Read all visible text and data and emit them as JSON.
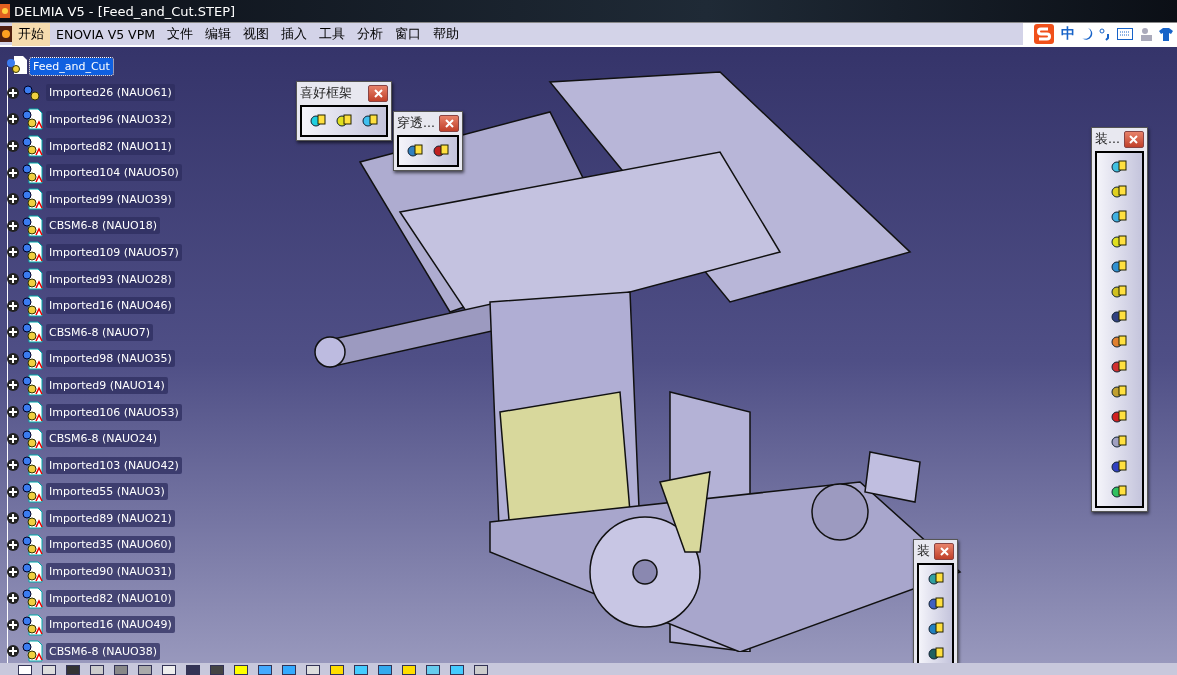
{
  "window": {
    "title": "DELMIA V5 - [Feed_and_Cut.STEP]"
  },
  "menu": [
    {
      "label": "开始",
      "selected": true
    },
    {
      "label": "ENOVIA V5 VPM",
      "selected": false
    },
    {
      "label": "文件",
      "selected": false
    },
    {
      "label": "编辑",
      "selected": false
    },
    {
      "label": "视图",
      "selected": false
    },
    {
      "label": "插入",
      "selected": false
    },
    {
      "label": "工具",
      "selected": false
    },
    {
      "label": "分析",
      "selected": false
    },
    {
      "label": "窗口",
      "selected": false
    },
    {
      "label": "帮助",
      "selected": false
    }
  ],
  "ime": {
    "mode": "中"
  },
  "tree": {
    "root": {
      "label": "Feed_and_Cut",
      "selected": true
    },
    "children": [
      {
        "label": "Imported26 (NAUO61)",
        "kind": "assembly",
        "expanded": false,
        "selected": false
      },
      {
        "label": "Imported96 (NAUO32)",
        "kind": "part",
        "expanded": false,
        "selected": false
      },
      {
        "label": "Imported82 (NAUO11)",
        "kind": "part",
        "expanded": false,
        "selected": false
      },
      {
        "label": "Imported104 (NAUO50)",
        "kind": "part",
        "expanded": false,
        "selected": false
      },
      {
        "label": "Imported99 (NAUO39)",
        "kind": "part",
        "expanded": false,
        "selected": false
      },
      {
        "label": "CBSM6-8 (NAUO18)",
        "kind": "part",
        "expanded": false,
        "selected": false
      },
      {
        "label": "Imported109 (NAUO57)",
        "kind": "part",
        "expanded": false,
        "selected": false
      },
      {
        "label": "Imported93 (NAUO28)",
        "kind": "part",
        "expanded": false,
        "selected": false
      },
      {
        "label": "Imported16 (NAUO46)",
        "kind": "part",
        "expanded": false,
        "selected": false
      },
      {
        "label": "CBSM6-8 (NAUO7)",
        "kind": "part",
        "expanded": false,
        "selected": false
      },
      {
        "label": "Imported98 (NAUO35)",
        "kind": "part",
        "expanded": false,
        "selected": false
      },
      {
        "label": "Imported9 (NAUO14)",
        "kind": "part",
        "expanded": false,
        "selected": false
      },
      {
        "label": "Imported106 (NAUO53)",
        "kind": "part",
        "expanded": false,
        "selected": false
      },
      {
        "label": "CBSM6-8 (NAUO24)",
        "kind": "part",
        "expanded": false,
        "selected": false
      },
      {
        "label": "Imported103 (NAUO42)",
        "kind": "part",
        "expanded": false,
        "selected": false
      },
      {
        "label": "Imported55 (NAUO3)",
        "kind": "part",
        "expanded": false,
        "selected": false
      },
      {
        "label": "Imported89 (NAUO21)",
        "kind": "part",
        "expanded": false,
        "selected": false
      },
      {
        "label": "Imported35 (NAUO60)",
        "kind": "part",
        "expanded": false,
        "selected": false
      },
      {
        "label": "Imported90 (NAUO31)",
        "kind": "part",
        "expanded": false,
        "selected": false
      },
      {
        "label": "Imported82 (NAUO10)",
        "kind": "part",
        "expanded": false,
        "selected": false
      },
      {
        "label": "Imported16 (NAUO49)",
        "kind": "part",
        "expanded": false,
        "selected": false
      },
      {
        "label": "CBSM6-8 (NAUO38)",
        "kind": "part",
        "expanded": false,
        "selected": false
      }
    ]
  },
  "toolbars": [
    {
      "title": "喜好框架",
      "kind": "favorites"
    },
    {
      "title": "穿透...",
      "kind": "transparency"
    },
    {
      "title": "装...",
      "kind": "assembly"
    },
    {
      "title": "装",
      "kind": "constraints"
    }
  ]
}
